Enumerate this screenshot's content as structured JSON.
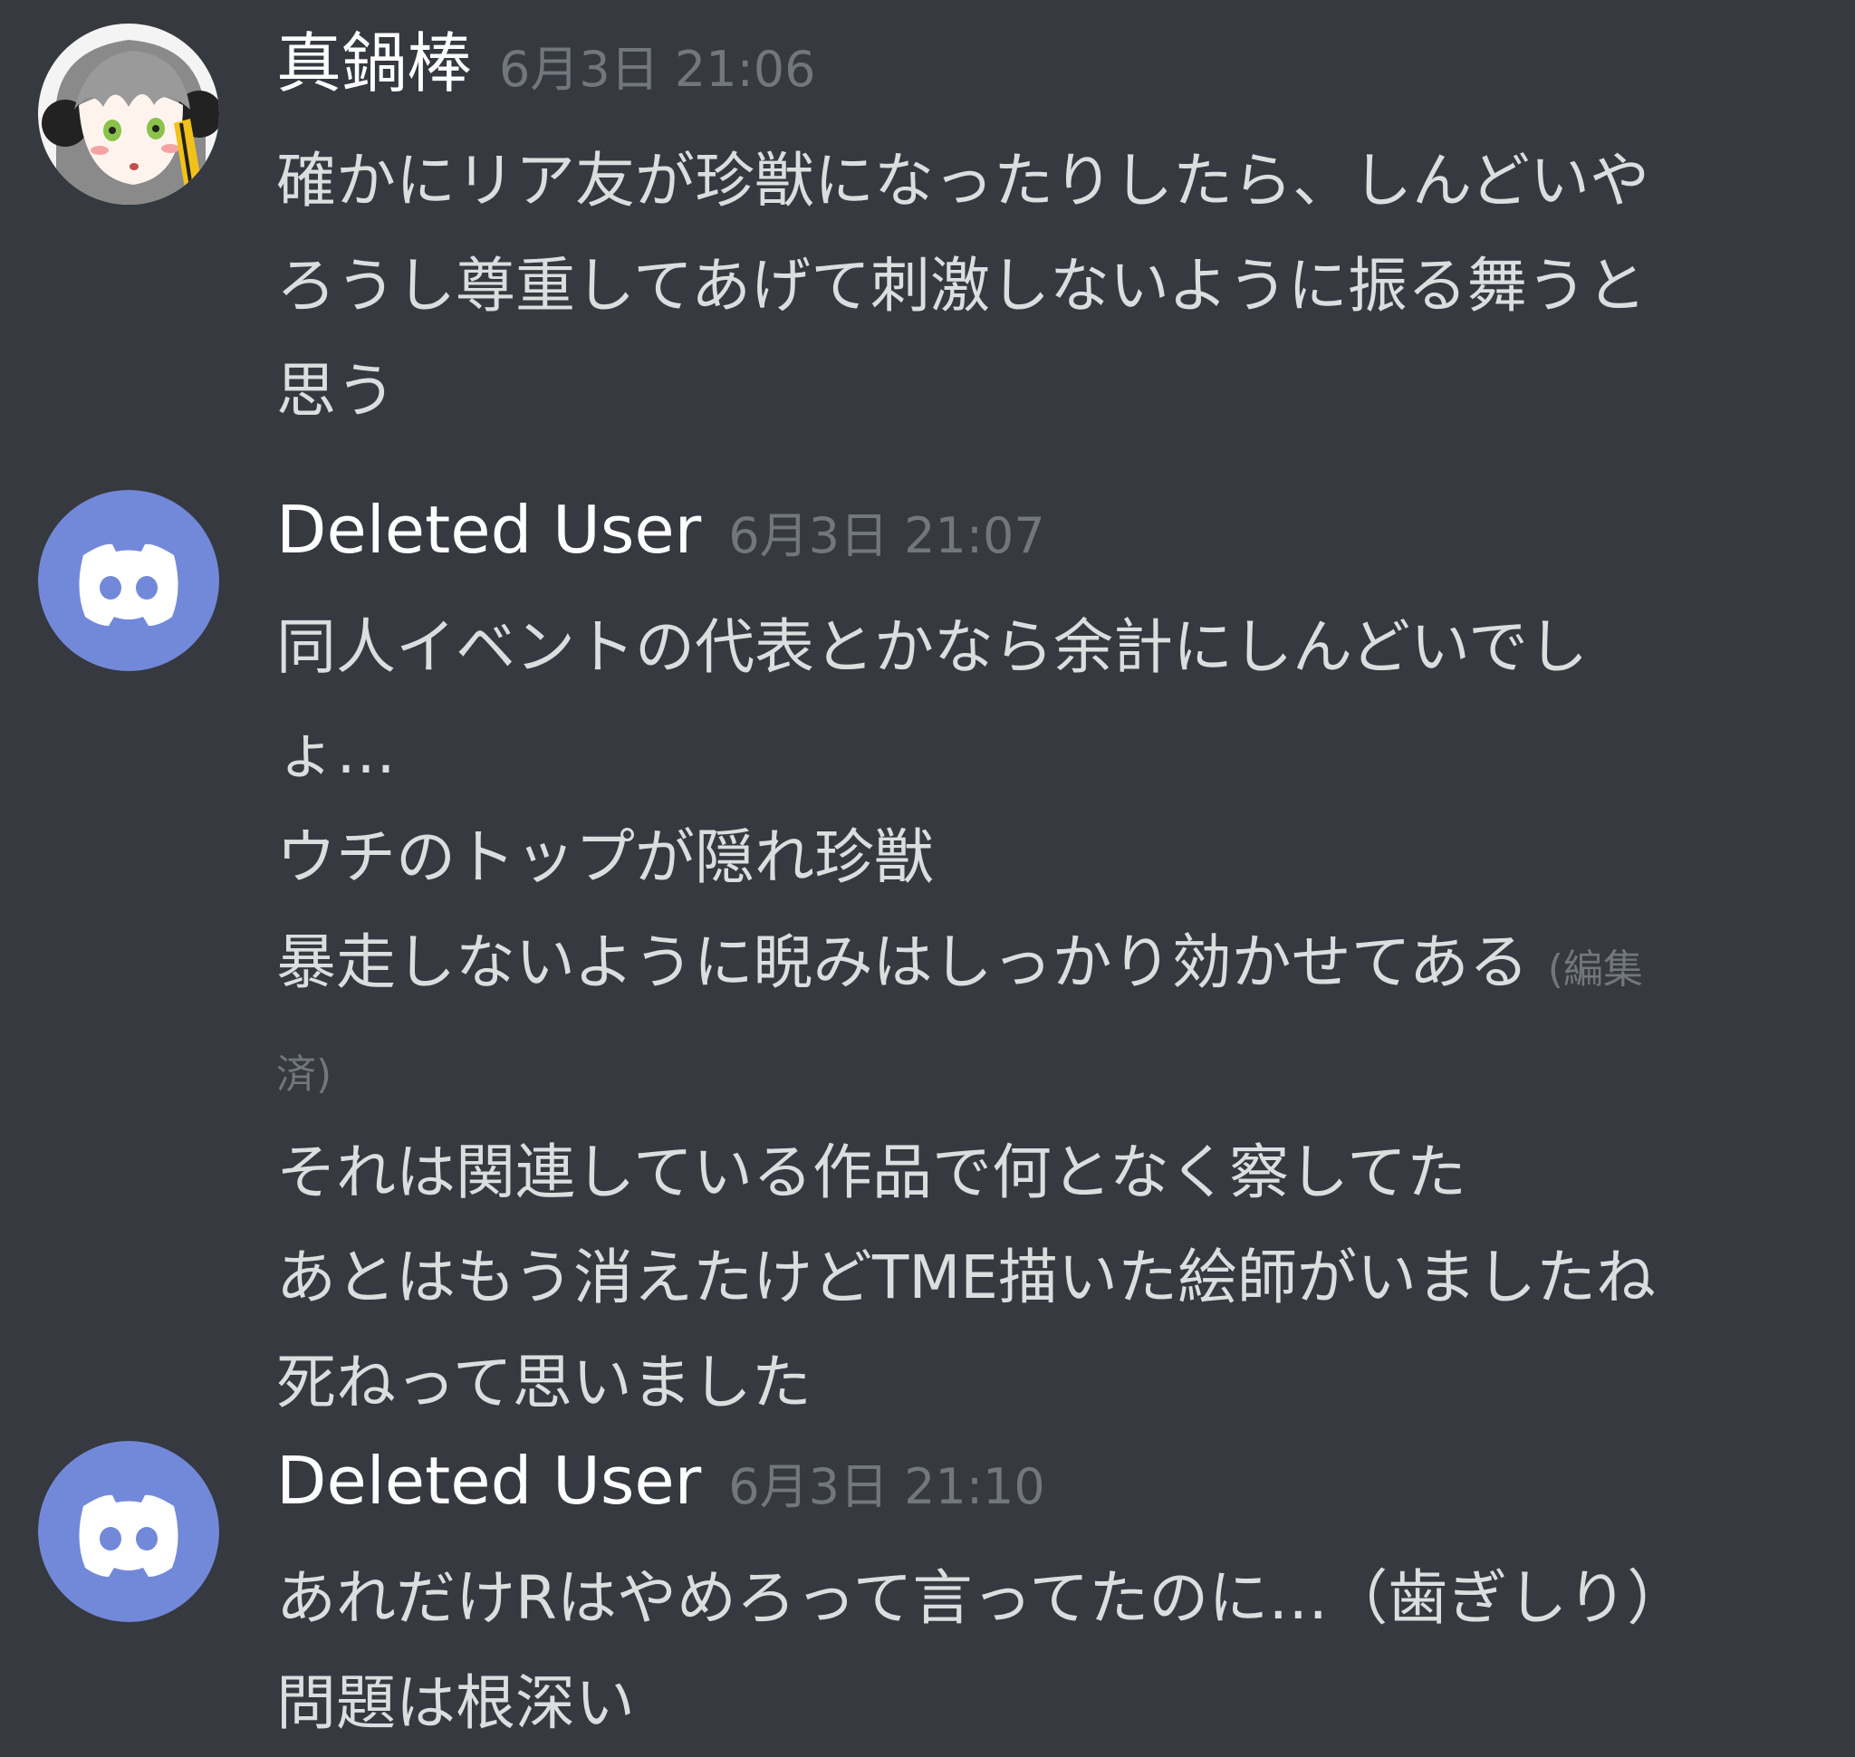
{
  "messages": [
    {
      "username": "真鍋棒",
      "timestamp": "6月3日 21:06",
      "lines": [
        "確かにリア友が珍獣になったりしたら、しんどいや",
        "ろうし尊重してあげて刺激しないように振る舞うと",
        "思う"
      ]
    },
    {
      "username": "Deleted User",
      "timestamp": "6月3日 21:07",
      "lines": [
        "同人イベントの代表とかなら余計にしんどいでし",
        "ょ…",
        "ウチのトップが隠れ珍獣",
        "暴走しないように睨みはしっかり効かせてある",
        "済)",
        "それは関連している作品で何となく察してた",
        "あとはもう消えたけどTME描いた絵師がいましたね",
        "死ねって思いました"
      ],
      "edited_label": "(編集"
    },
    {
      "username": "Deleted User",
      "timestamp": "6月3日 21:10",
      "lines": [
        "あれだけRはやめろって言ってたのに…（歯ぎしり）",
        "問題は根深い"
      ]
    }
  ],
  "colors": {
    "background": "#36393f",
    "username": "#ffffff",
    "text": "#dcddde",
    "muted": "#72767d",
    "discord_blurple": "#7289da"
  },
  "icons": {
    "user_avatar": "anime-avatar-icon",
    "deleted_avatar": "discord-logo-icon"
  }
}
